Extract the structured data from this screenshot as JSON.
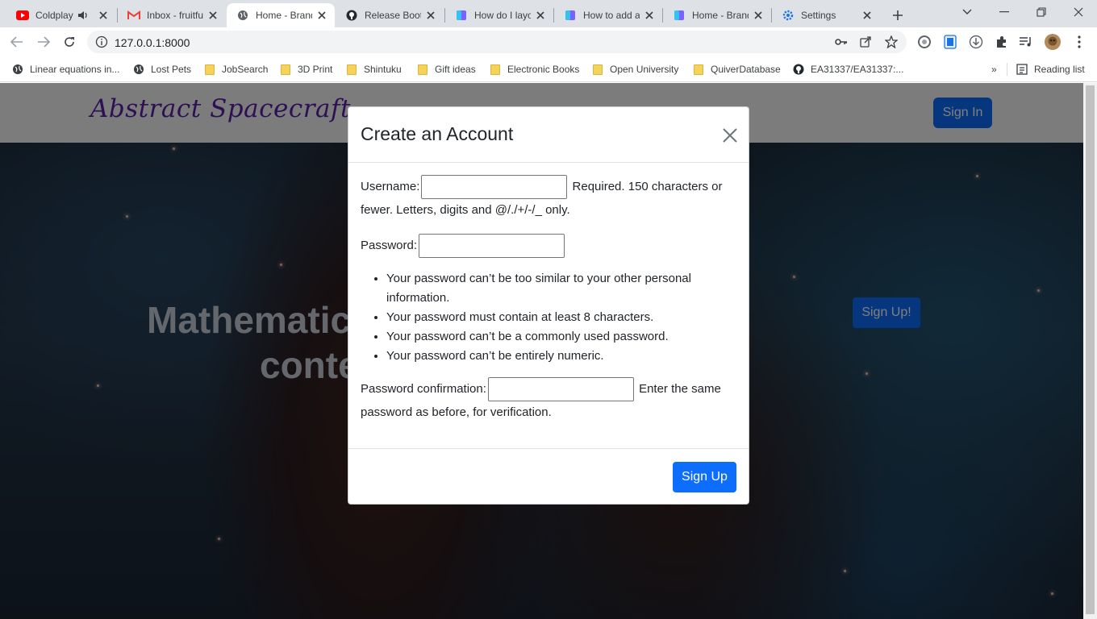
{
  "browser": {
    "tabs": [
      {
        "title": "Coldplay",
        "favicon": "youtube-icon",
        "audio": true
      },
      {
        "title": "Inbox - fruitfu",
        "favicon": "gmail-icon"
      },
      {
        "title": "Home - Brand",
        "favicon": "globe-icon",
        "active": true
      },
      {
        "title": "Release Boots",
        "favicon": "github-icon"
      },
      {
        "title": "How do I layo",
        "favicon": "page-icon"
      },
      {
        "title": "How to add a",
        "favicon": "page-icon"
      },
      {
        "title": "Home - Brand",
        "favicon": "page-icon"
      },
      {
        "title": "Settings",
        "favicon": "gear-icon"
      }
    ],
    "url": "127.0.0.1:8000",
    "bookmarks": [
      {
        "label": "Linear equations in...",
        "icon": "globe-icon"
      },
      {
        "label": "Lost Pets",
        "icon": "globe-icon"
      },
      {
        "label": "JobSearch",
        "icon": "folder-icon"
      },
      {
        "label": "3D Print",
        "icon": "folder-icon"
      },
      {
        "label": "Shintuku",
        "icon": "folder-icon"
      },
      {
        "label": "Gift ideas",
        "icon": "folder-icon"
      },
      {
        "label": "Electronic Books",
        "icon": "folder-icon"
      },
      {
        "label": "Open University",
        "icon": "folder-icon"
      },
      {
        "label": "QuiverDatabase",
        "icon": "folder-icon"
      },
      {
        "label": "EA31337/EA31337:...",
        "icon": "github-icon"
      }
    ],
    "bookmarks_overflow": "»",
    "reading_list": "Reading list"
  },
  "page": {
    "brand": "Abstract Spacecraft",
    "signin_label": "Sign In",
    "hero_line1": "Mathematic",
    "hero_line2": "conte",
    "hero_button": "Sign Up!"
  },
  "modal": {
    "title": "Create an Account",
    "username_label": "Username:",
    "username_help": "Required. 150 characters or fewer. Letters, digits and @/./+/-/_ only.",
    "password_label": "Password:",
    "password_rules": [
      "Your password can’t be too similar to your other personal information.",
      "Your password must contain at least 8 characters.",
      "Your password can’t be a commonly used password.",
      "Your password can’t be entirely numeric."
    ],
    "confirm_label": "Password confirmation:",
    "confirm_help": "Enter the same password as before, for verification.",
    "submit_label": "Sign Up"
  },
  "colors": {
    "primary": "#0d6efd",
    "brand": "#5a1fa6"
  }
}
